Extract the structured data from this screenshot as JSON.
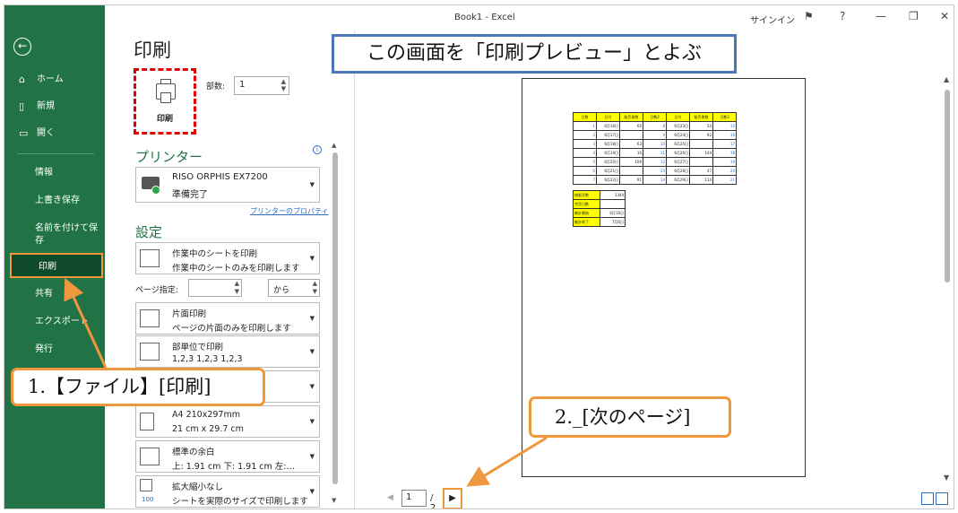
{
  "window": {
    "title": "Book1  -  Excel",
    "signin": "サインイン"
  },
  "sidebar": {
    "items": [
      "ホーム",
      "新規",
      "開く",
      "情報",
      "上書き保存",
      "名前を付けて保存",
      "印刷",
      "共有",
      "エクスポート",
      "発行"
    ]
  },
  "print": {
    "title": "印刷",
    "button": "印刷",
    "copies_label": "部数:",
    "copies_value": "1",
    "printer_head": "プリンター",
    "printer_name": "RISO ORPHIS EX7200",
    "printer_status": "準備完了",
    "printer_props": "プリンターのプロパティ",
    "settings_head": "設定",
    "opt_sheet_1": "作業中のシートを印刷",
    "opt_sheet_2": "作業中のシートのみを印刷します",
    "pages_label": "ページ指定:",
    "pages_to": "から",
    "opt_side_1": "片面印刷",
    "opt_side_2": "ページの片面のみを印刷します",
    "opt_collate_1": "部単位で印刷",
    "opt_collate_2": "1,2,3    1,2,3    1,2,3",
    "opt_paper_1": "A4 210x297mm",
    "opt_paper_2": "21 cm x 29.7 cm",
    "opt_margin_1": "標準の余白",
    "opt_margin_2": "上: 1.91 cm 下: 1.91 cm 左:…",
    "opt_scale_1": "拡大縮小なし",
    "opt_scale_2": "シートを実際のサイズで印刷します",
    "opt_scale_num": "100"
  },
  "preview": {
    "page_value": "1",
    "page_of": "/ 2",
    "headers": [
      "日数",
      "日付",
      "販売冊数",
      "日数2",
      "日付",
      "販売冊数",
      "日数3"
    ],
    "rows": [
      [
        "1",
        "6月16日",
        "60",
        "8",
        "6月23日",
        "54",
        "15"
      ],
      [
        "2",
        "6月17日",
        "",
        "9",
        "6月24日",
        "92",
        "16"
      ],
      [
        "3",
        "6月18日",
        "63",
        "10",
        "6月25日",
        "",
        "17"
      ],
      [
        "4",
        "6月19日",
        "16",
        "11",
        "6月26日",
        "144",
        "18"
      ],
      [
        "5",
        "6月20日",
        "109",
        "12",
        "6月27日",
        "",
        "19"
      ],
      [
        "6",
        "6月21日",
        "",
        "13",
        "6月28日",
        "47",
        "20"
      ],
      [
        "7",
        "6月22日",
        "91",
        "14",
        "6月29日",
        "114",
        "21"
      ]
    ],
    "summary": [
      [
        "総販売数",
        "1344"
      ],
      [
        "完売日数",
        ""
      ],
      [
        "集計開始",
        "6月16日"
      ],
      [
        "集計終了",
        "7月6日"
      ]
    ]
  },
  "annotations": {
    "top": "この画面を「印刷プレビュー」とよぶ",
    "one": "1.【ファイル】[印刷]",
    "two": "2._[次のページ]"
  },
  "colors": {
    "excel_green": "#217346",
    "accent_orange": "#f0963c",
    "callout_blue": "#4a76b8",
    "highlight_red": "#e00000"
  }
}
